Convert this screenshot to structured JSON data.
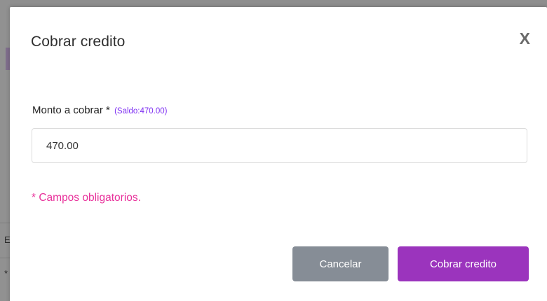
{
  "background": {
    "fragment_1": "E",
    "fragment_2": "*"
  },
  "modal": {
    "title": "Cobrar credito",
    "close_label": "X",
    "field": {
      "label": "Monto a cobrar *",
      "saldo_hint": "(Saldo:470.00)",
      "value": "470.00"
    },
    "required_note": "* Campos obligatorios.",
    "buttons": {
      "cancel_label": "Cancelar",
      "submit_label": "Cobrar credito"
    }
  },
  "colors": {
    "accent": "#9b34bd",
    "saldo": "#7d2ef2",
    "required": "#e8309a",
    "cancel": "#868d96"
  }
}
